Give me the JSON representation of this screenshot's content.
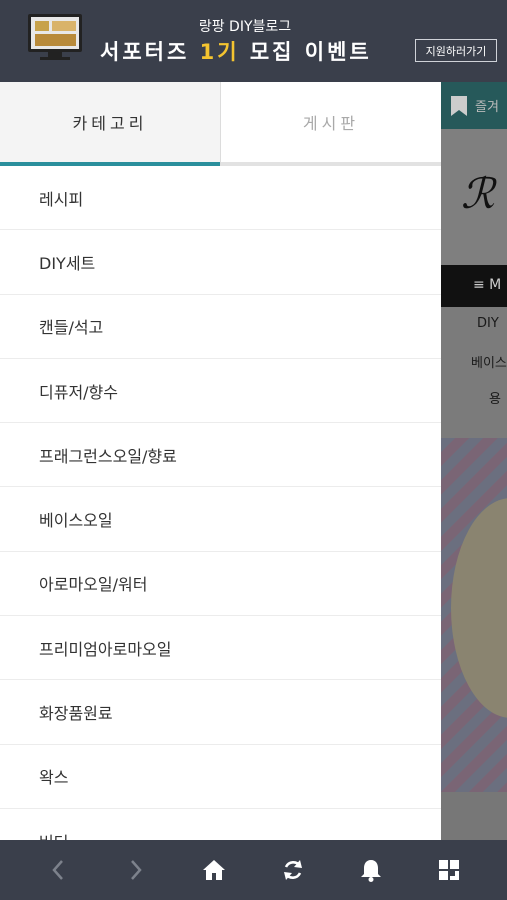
{
  "banner": {
    "subtitle": "랑팡 DIY블로그",
    "title_part1": "서포터즈 ",
    "title_highlight": "1기",
    "title_part2": " 모집 이벤트",
    "apply_button": "지원하러가기",
    "highlight_color": "#f4c430"
  },
  "drawer": {
    "tabs": [
      {
        "label": "카테고리",
        "active": true
      },
      {
        "label": "게시판",
        "active": false
      }
    ],
    "items": [
      {
        "label": "레시피"
      },
      {
        "label": "DIY세트"
      },
      {
        "label": "캔들/석고"
      },
      {
        "label": "디퓨저/향수"
      },
      {
        "label": "프래그런스오일/향료"
      },
      {
        "label": "베이스오일"
      },
      {
        "label": "아로마오일/워터"
      },
      {
        "label": "프리미엄아로마오일"
      },
      {
        "label": "화장품원료"
      },
      {
        "label": "왁스"
      },
      {
        "label": "버터"
      }
    ],
    "accent_color": "#2a8f9c"
  },
  "background_page": {
    "favorite_label": "즐겨",
    "menu_label": "≡ M",
    "rows": [
      "DIY",
      "베이스",
      "용"
    ]
  },
  "bottom_bar": {
    "icons": [
      "back-icon",
      "forward-icon",
      "home-icon",
      "refresh-icon",
      "bell-icon",
      "grid-icon"
    ]
  }
}
